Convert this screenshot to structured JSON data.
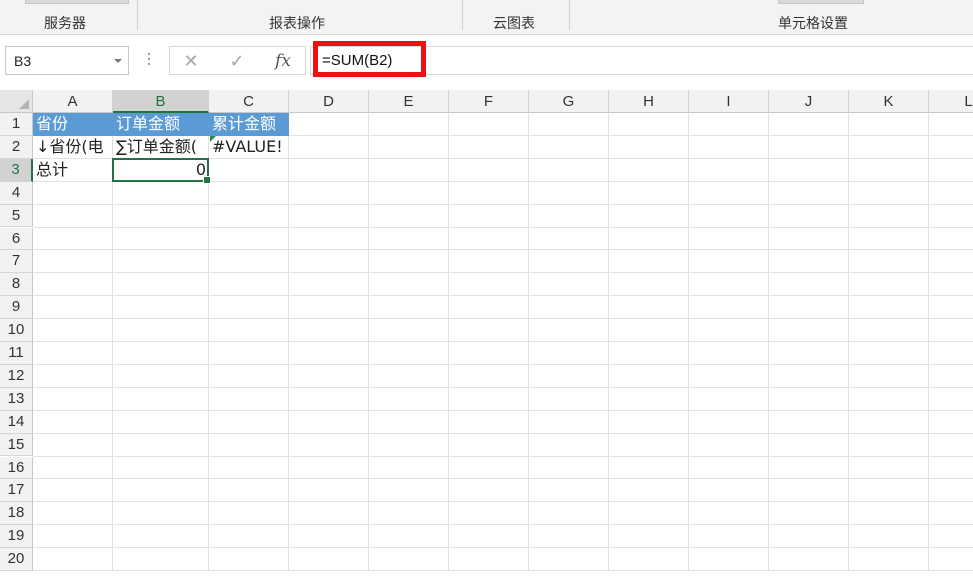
{
  "ribbon": {
    "groups": [
      "服务器",
      "报表操作",
      "云图表",
      "单元格设置"
    ]
  },
  "formula_bar": {
    "name_box": "B3",
    "cancel_icon": "✕",
    "enter_icon": "✓",
    "fx_label": "fx",
    "formula": "=SUM(B2)"
  },
  "sheet": {
    "columns": [
      "A",
      "B",
      "C",
      "D",
      "E",
      "F",
      "G",
      "H",
      "I",
      "J",
      "K",
      "L"
    ],
    "rows": [
      "1",
      "2",
      "3",
      "4",
      "5",
      "6",
      "7",
      "8",
      "9",
      "10",
      "11",
      "12",
      "13",
      "14",
      "15",
      "16",
      "17",
      "18",
      "19",
      "20"
    ],
    "selected_cell": "B3",
    "cells": {
      "A1": "省份",
      "B1": "订单金额",
      "C1": "累计金额",
      "A2": "↓省份(电",
      "B2": "∑订单金额(",
      "C2": "#VALUE!",
      "A3": "总计",
      "B3": "0"
    }
  },
  "colors": {
    "header_fill": "#5b9bd5",
    "selection": "#217346",
    "highlight": "#ee1111"
  }
}
